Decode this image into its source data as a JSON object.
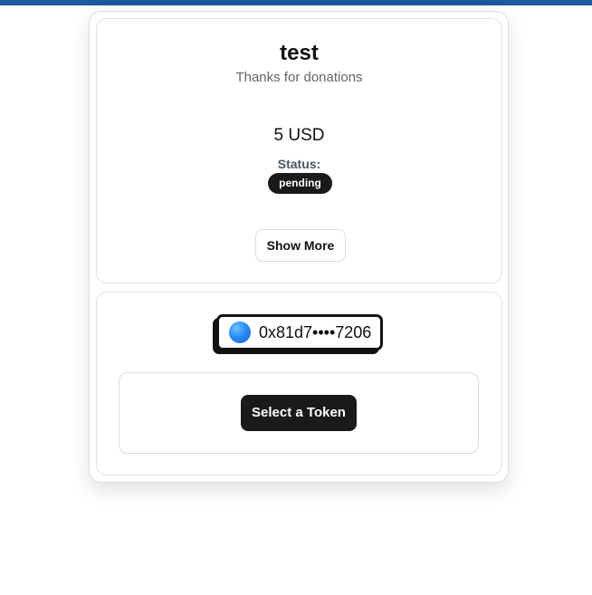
{
  "payment": {
    "title": "test",
    "description": "Thanks for donations",
    "amount": "5 USD",
    "status_label": "Status:",
    "status_value": "pending",
    "show_more_label": "Show More"
  },
  "wallet": {
    "address": "0x81d7••••7206",
    "avatar_icon": "wallet-avatar-icon"
  },
  "token": {
    "select_label": "Select a Token"
  },
  "colors": {
    "top_bar": "#1f57a0",
    "dark_button": "#1a1a1a",
    "status_label": "#4a5568"
  }
}
